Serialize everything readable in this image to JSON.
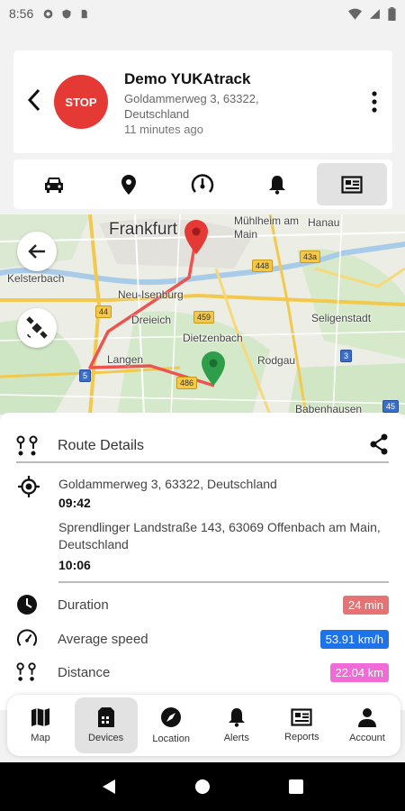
{
  "status_bar": {
    "time": "8:56"
  },
  "header": {
    "status_badge": "STOP",
    "device_name": "Demo YUKAtrack",
    "address": "Goldammerweg 3, 63322, Deutschland",
    "updated": "11 minutes ago"
  },
  "tabs": [
    {
      "icon": "car-icon",
      "active": false
    },
    {
      "icon": "location-pin-icon",
      "active": false
    },
    {
      "icon": "speedometer-icon",
      "active": false
    },
    {
      "icon": "bell-icon",
      "active": false
    },
    {
      "icon": "report-icon",
      "active": true
    }
  ],
  "map": {
    "labels": {
      "frankfurt": "Frankfurt",
      "muhlheim": "Mühlheim am Main",
      "hanau": "Hanau",
      "kelsterbach": "Kelsterbach",
      "neu_isenburg": "Neu-Isenburg",
      "dreieich": "Dreieich",
      "seligenstadt": "Seligenstadt",
      "dietzenbach": "Dietzenbach",
      "langen": "Langen",
      "rodgau": "Rodgau",
      "babenhausen": "Babenhausen"
    },
    "shields": {
      "s448": "448",
      "s43a": "43a",
      "s44": "44",
      "s459": "459",
      "s3": "3",
      "s5": "5",
      "s486": "486",
      "s45": "45"
    },
    "colors": {
      "start_pin": "#e53935",
      "end_pin": "#2e9e4a",
      "route": "#ef5350"
    }
  },
  "route_details": {
    "title": "Route Details",
    "start_address": "Goldammerweg 3, 63322, Deutschland",
    "start_time": "09:42",
    "end_address": "Sprendlinger Landstraße 143, 63069 Offenbach am Main, Deutschland",
    "end_time": "10:06",
    "stats": {
      "duration_label": "Duration",
      "duration_value": "24 min",
      "duration_color": "#e57373",
      "speed_label": "Average speed",
      "speed_value": "53.91 km/h",
      "speed_color": "#1e73e8",
      "distance_label": "Distance",
      "distance_value": "22.04 km",
      "distance_color": "#f06bd8"
    }
  },
  "bottom_nav": [
    {
      "label": "Map",
      "icon": "map-icon"
    },
    {
      "label": "Devices",
      "icon": "devices-icon",
      "active": true
    },
    {
      "label": "Location",
      "icon": "compass-icon"
    },
    {
      "label": "Alerts",
      "icon": "bell-icon"
    },
    {
      "label": "Reports",
      "icon": "report-icon"
    },
    {
      "label": "Account",
      "icon": "person-icon"
    }
  ]
}
